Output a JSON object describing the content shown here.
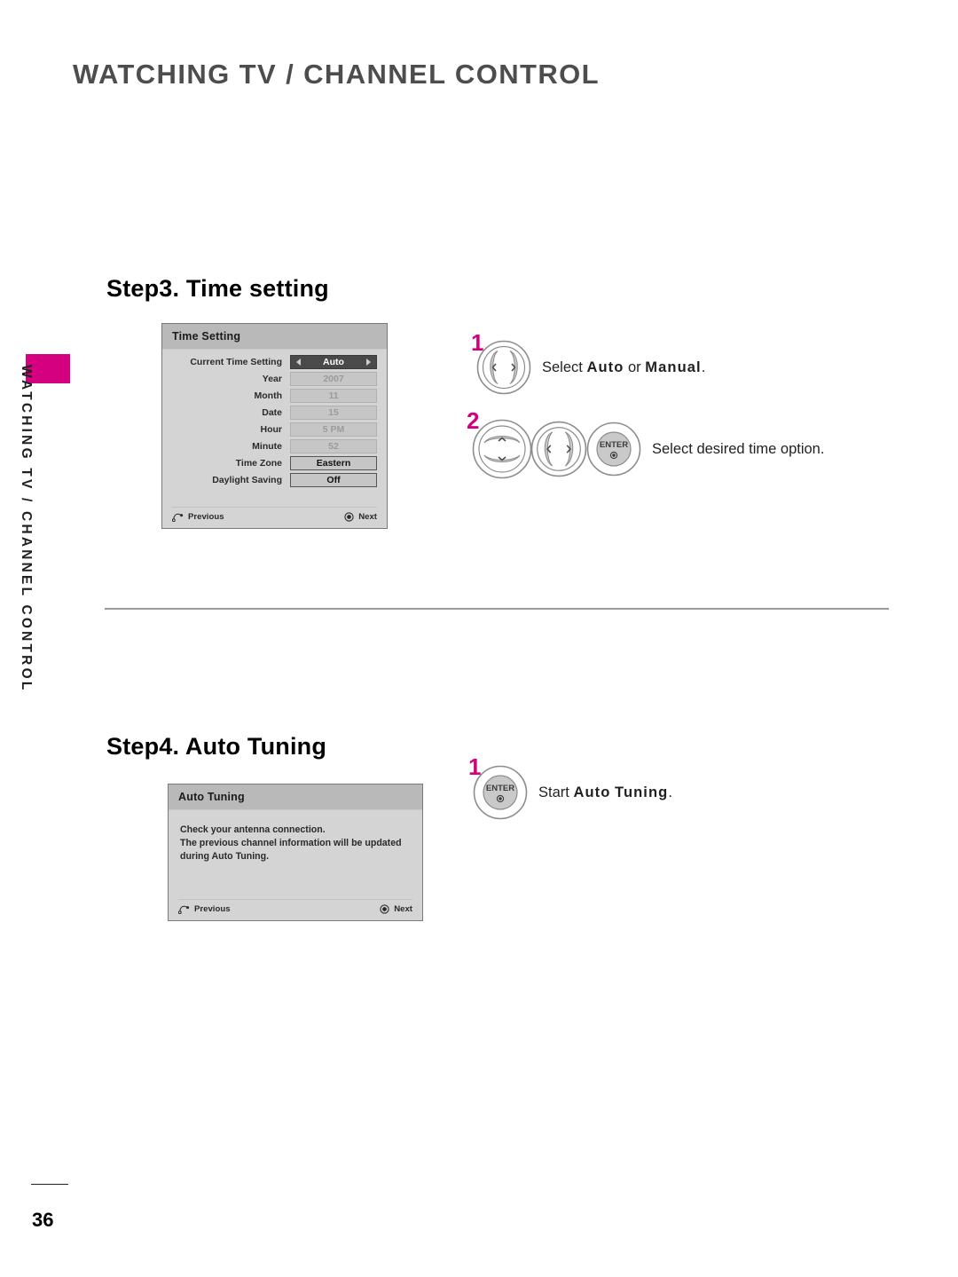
{
  "header": {
    "title": "WATCHING TV / CHANNEL CONTROL"
  },
  "sidebar": {
    "chapter_label": "WATCHING TV / CHANNEL CONTROL",
    "tab_color": "#d4007f"
  },
  "step3": {
    "heading": "Step3. Time setting",
    "dialog": {
      "title": "Time Setting",
      "rows": [
        {
          "label": "Current Time Setting",
          "value": "Auto",
          "state": "active"
        },
        {
          "label": "Year",
          "value": "2007",
          "state": "disabled"
        },
        {
          "label": "Month",
          "value": "11",
          "state": "disabled"
        },
        {
          "label": "Date",
          "value": "15",
          "state": "disabled"
        },
        {
          "label": "Hour",
          "value": "5 PM",
          "state": "disabled"
        },
        {
          "label": "Minute",
          "value": "52",
          "state": "disabled"
        },
        {
          "label": "Time Zone",
          "value": "Eastern",
          "state": "enabled"
        },
        {
          "label": "Daylight Saving",
          "value": "Off",
          "state": "enabled"
        }
      ],
      "footer": {
        "previous": "Previous",
        "next": "Next"
      }
    },
    "instructions": [
      {
        "number": "1",
        "icon": "left-right-button",
        "text_prefix": "Select ",
        "bold_1": "Auto",
        "text_mid": " or ",
        "bold_2": "Manual",
        "text_suffix": "."
      },
      {
        "number": "2",
        "icon": "up-down-button",
        "icon2": "left-right-button",
        "icon3": "enter-button",
        "text_prefix": "Select desired time option.",
        "bold_1": "",
        "text_mid": "",
        "bold_2": "",
        "text_suffix": ""
      }
    ]
  },
  "step4": {
    "heading": "Step4. Auto Tuning",
    "dialog": {
      "title": "Auto Tuning",
      "line1": "Check your antenna connection.",
      "line2": "The previous channel information will be updated",
      "line3": "during Auto Tuning.",
      "footer": {
        "previous": "Previous",
        "next": "Next"
      }
    },
    "instruction": {
      "number": "1",
      "icon": "enter-button",
      "text_prefix": "Start ",
      "bold_1": "Auto",
      "text_mid": " ",
      "bold_2": "Tuning",
      "text_suffix": "."
    }
  },
  "footer": {
    "page_number": "36"
  },
  "icons": {
    "enter_label": "ENTER",
    "previous_icon": "return-arrow-icon",
    "next_icon": "enter-dot-icon"
  }
}
